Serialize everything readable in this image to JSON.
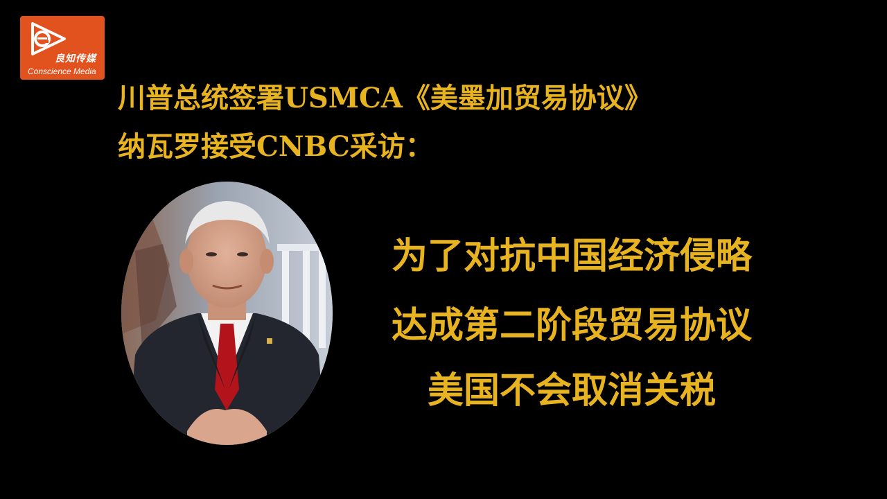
{
  "brand": {
    "name_cn": "良知传媒",
    "name_en": "Conscience Media",
    "logo_color": "#e2521f",
    "logo_icon": "e-play-logo-icon"
  },
  "headline": {
    "line1": "川普总统签署USMCA《美墨加贸易协议》",
    "line2": "纳瓦罗接受CNBC采访："
  },
  "quote": {
    "line1": "为了对抗中国经济侵略",
    "line2": "达成第二阶段贸易协议",
    "line3": "美国不会取消关税"
  },
  "colors": {
    "background": "#000000",
    "text_accent": "#e8b320"
  }
}
